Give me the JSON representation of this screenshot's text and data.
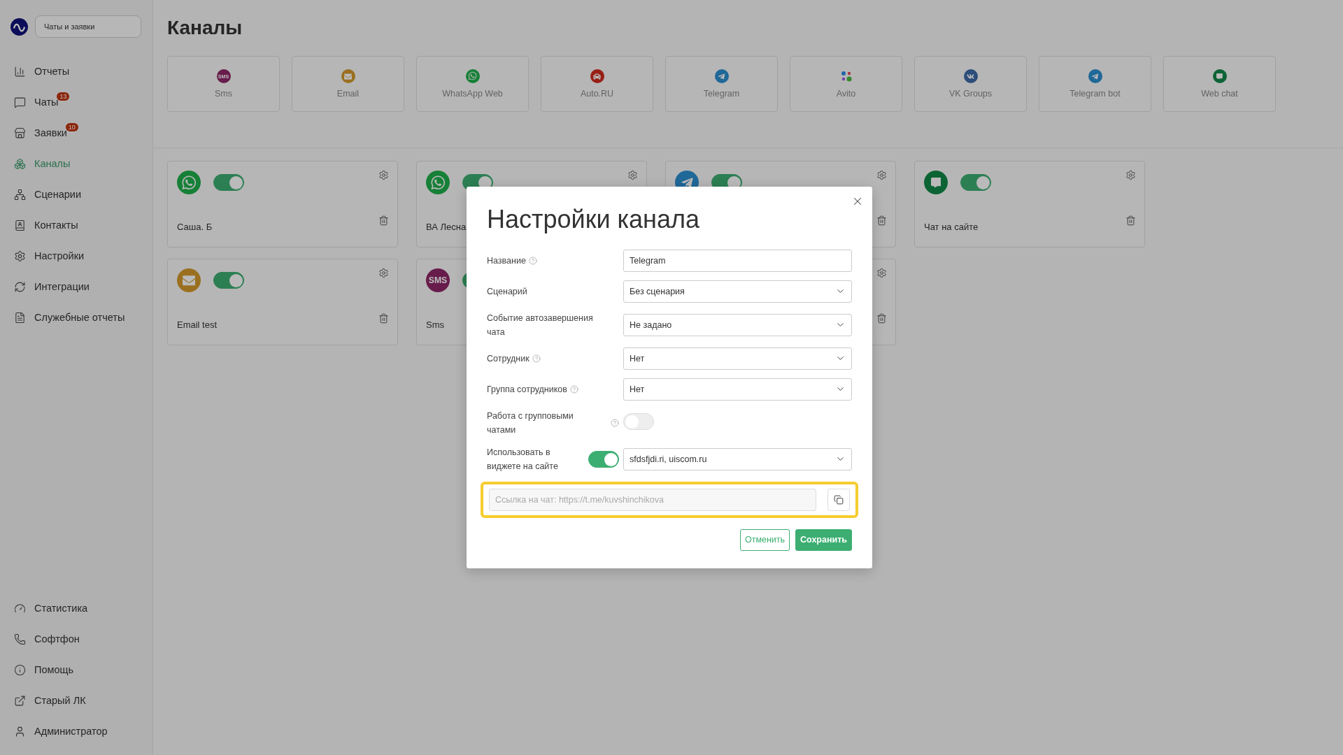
{
  "sidebar": {
    "section_button": "Чаты и заявки",
    "items": [
      {
        "label": "Отчеты",
        "selected": false
      },
      {
        "label": "Чаты",
        "badge": "13",
        "selected": false
      },
      {
        "label": "Заявки",
        "badge": "10",
        "selected": false
      },
      {
        "label": "Каналы",
        "selected": true
      },
      {
        "label": "Сценарии",
        "selected": false
      },
      {
        "label": "Контакты",
        "selected": false
      },
      {
        "label": "Настройки",
        "selected": false
      },
      {
        "label": "Интеграции",
        "selected": false
      },
      {
        "label": "Служебные отчеты",
        "selected": false
      }
    ],
    "bottom_items": [
      {
        "label": "Статистика"
      },
      {
        "label": "Софтфон"
      },
      {
        "label": "Помощь"
      },
      {
        "label": "Старый ЛК"
      },
      {
        "label": "Администратор"
      }
    ]
  },
  "page_title": "Каналы",
  "channel_types": [
    {
      "kind": "sms",
      "icon_text": "SMS",
      "label": "Sms"
    },
    {
      "kind": "email",
      "label": "Email"
    },
    {
      "kind": "whatsapp",
      "label": "WhatsApp Web"
    },
    {
      "kind": "autoru",
      "label": "Auto.RU"
    },
    {
      "kind": "telegram",
      "label": "Telegram"
    },
    {
      "kind": "avito",
      "label": "Avito"
    },
    {
      "kind": "vk",
      "label": "VK Groups"
    },
    {
      "kind": "telegram",
      "label": "Telegram bot"
    },
    {
      "kind": "webchat",
      "label": "Web chat"
    }
  ],
  "channels": [
    {
      "kind": "whatsapp",
      "on": true,
      "name": "Саша. Б",
      "actions": true
    },
    {
      "kind": "whatsapp",
      "on": true,
      "name": "ВА Лесна",
      "actions": true
    },
    {
      "kind": "telegram",
      "on": true,
      "actions": true
    },
    {
      "kind": "webchat",
      "on": true,
      "name": "Чат на сайте",
      "actions": true
    },
    {
      "kind": "email",
      "on": true,
      "name": "Email test",
      "actions": true
    },
    {
      "kind": "sms",
      "icon_text": "SMS",
      "on": true,
      "name": "Sms",
      "actions": false
    },
    {
      "kind": "hidden",
      "actions": true
    }
  ],
  "dialog": {
    "title": "Настройки канала",
    "fields": [
      {
        "kind": "text",
        "label": "Название",
        "help": true,
        "value": "Telegram"
      },
      {
        "kind": "select",
        "label": "Сценарий",
        "help": false,
        "value": "Без сценария"
      },
      {
        "kind": "select",
        "label": "Событие автозавершения чата",
        "help": false,
        "value": "Не задано"
      },
      {
        "kind": "select",
        "label": "Сотрудник",
        "help": true,
        "value": "Нет"
      },
      {
        "kind": "select",
        "label": "Группа сотрудников",
        "help": true,
        "value": "Нет"
      },
      {
        "kind": "switch",
        "label": "Работа с групповыми чатами",
        "help": true,
        "on": false
      },
      {
        "kind": "switch_select",
        "label": "Использовать в виджете на сайте",
        "help": false,
        "on": true,
        "value": "sfdsfjdi.ri, uiscom.ru"
      }
    ],
    "link": {
      "placeholder": "Ссылка на чат: https://t.me/kuvshinchikova",
      "highlighted": true
    },
    "buttons": [
      {
        "kind": "secondary",
        "label": "Отменить"
      },
      {
        "kind": "primary",
        "label": "Сохранить"
      }
    ]
  }
}
